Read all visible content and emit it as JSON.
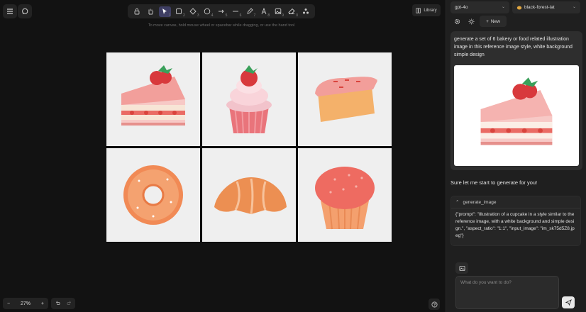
{
  "canvas": {
    "hint": "To move canvas, hold mouse wheel or spacebar while dragging, or use the hand tool",
    "library_label": "Library",
    "zoom_label": "27%",
    "zoom_minus": "−",
    "zoom_plus": "+",
    "tools": [
      {
        "name": "lock-tool",
        "icon": "lock-icon",
        "num": ""
      },
      {
        "name": "hand-tool",
        "icon": "hand-icon",
        "num": ""
      },
      {
        "name": "selection-tool",
        "icon": "pointer-icon",
        "num": "1",
        "active": true
      },
      {
        "name": "rectangle-tool",
        "icon": "rectangle-icon",
        "num": "2"
      },
      {
        "name": "diamond-tool",
        "icon": "diamond-icon",
        "num": "3"
      },
      {
        "name": "ellipse-tool",
        "icon": "ellipse-icon",
        "num": "4"
      },
      {
        "name": "arrow-tool",
        "icon": "arrow-icon",
        "num": "5"
      },
      {
        "name": "line-tool",
        "icon": "line-icon",
        "num": "6"
      },
      {
        "name": "draw-tool",
        "icon": "pencil-icon",
        "num": "7"
      },
      {
        "name": "text-tool",
        "icon": "text-icon",
        "num": "8"
      },
      {
        "name": "image-tool",
        "icon": "image-icon",
        "num": "9"
      },
      {
        "name": "eraser-tool",
        "icon": "eraser-icon",
        "num": "0"
      },
      {
        "name": "more-tools",
        "icon": "shapes-icon",
        "num": ""
      }
    ],
    "images": [
      {
        "name": "strawberry-cake-slice-image",
        "icon": "cake-slice"
      },
      {
        "name": "cupcake-image",
        "icon": "cupcake"
      },
      {
        "name": "pound-cake-image",
        "icon": "pound-cake"
      },
      {
        "name": "donut-image",
        "icon": "donut"
      },
      {
        "name": "croissant-image",
        "icon": "croissant"
      },
      {
        "name": "muffin-image",
        "icon": "muffin"
      }
    ]
  },
  "panel": {
    "model_select": "gpt-4o",
    "image_model_select": "black-forest-lat",
    "new_label": "New",
    "user_message": "generate a set of 6 bakery or food related illustration image in this reference image style, white background simple design",
    "assistant_reply": "Sure let me start to generate for you!",
    "tool_call_name": "generate_image",
    "tool_call_args": "{\"prompt\": \"Illustration of a cupcake in a style similar to the reference image, with a white background and simple design.\", \"aspect_ratio\": \"1:1\", \"input_image\": \"im_sk75d5Z8.jpeg\"}",
    "input_placeholder": "What do you want to do?"
  },
  "colors": {
    "background": "#121212",
    "panel": "#1f1f1f",
    "active_tool": "#3e3e63",
    "tile_bg": "#efefef"
  }
}
